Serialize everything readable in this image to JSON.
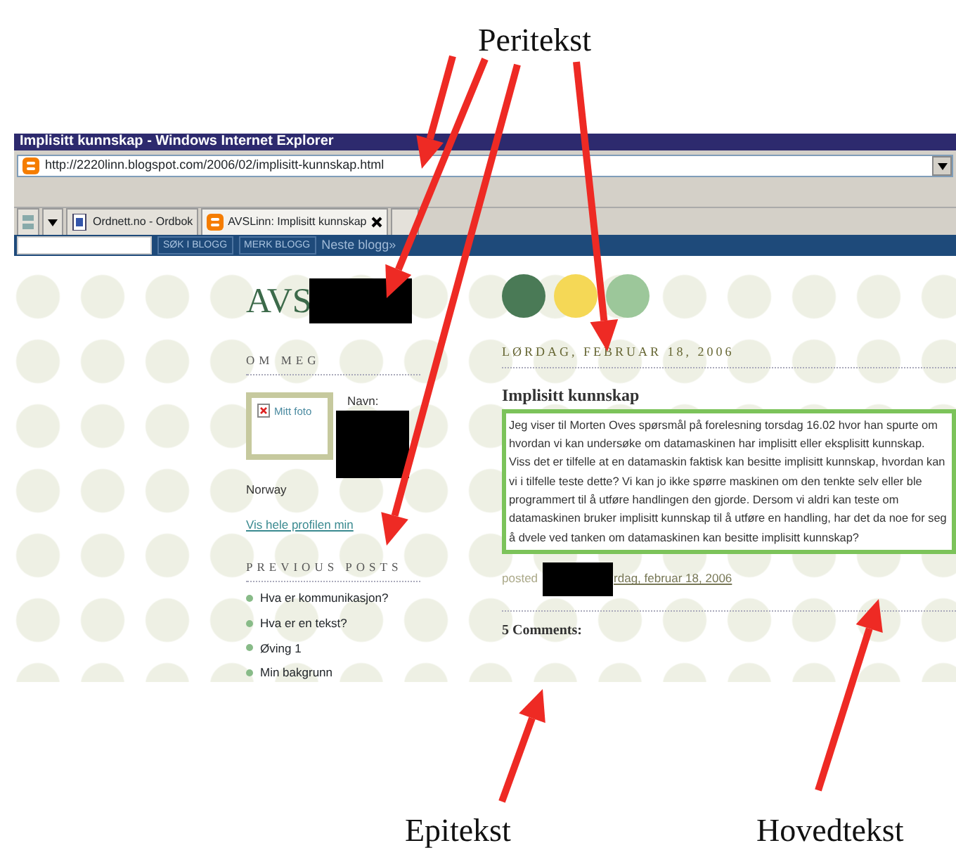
{
  "annotations": [
    {
      "label": "Peritekst"
    },
    {
      "label": "Epitekst"
    },
    {
      "label": "Hovedtekst"
    }
  ],
  "browser": {
    "title": "Implisitt kunnskap - Windows Internet Explorer",
    "address": "http://2220linn.blogspot.com/2006/02/implisitt-kunnskap.html",
    "tabs": [
      {
        "label": "Ordnett.no - Ordbok",
        "selected": false
      },
      {
        "label": "AVSLinn: Implisitt kunnskap",
        "selected": true
      }
    ]
  },
  "blog_navbar": {
    "buttons": [
      "SØK I BLOGG",
      "MERK BLOGG"
    ],
    "link": "Neste blogg»"
  },
  "blog": {
    "title": "AVS",
    "sidebar": {
      "about_heading": "OM MEG",
      "photo_alt": "Mitt foto",
      "name_label": "Navn:",
      "location": "Norway",
      "profile_link": "Vis hele profilen min",
      "previous_heading": "PREVIOUS POSTS",
      "previous_posts": [
        "Hva er kommunikasjon?",
        "Hva er en tekst?",
        "Øving 1",
        "Min bakgrunn"
      ]
    },
    "post": {
      "date": "LØRDAG, FEBRUAR 18, 2006",
      "title": "Implisitt kunnskap",
      "body": "Jeg viser til Morten Oves spørsmål på forelesning torsdag 16.02 hvor han spurte om hvordan vi kan undersøke om datamaskinen har implisitt eller eksplisitt kunnskap. Viss det er tilfelle at en datamaskin faktisk kan besitte implisitt kunnskap, hvordan kan vi i tilfelle teste dette? Vi kan jo ikke spørre maskinen om den tenkte selv eller ble programmert til å utføre handlingen den gjorde. Dersom vi aldri kan teste om datamaskinen bruker implisitt kunnskap til å utføre en handling, har det da noe for seg å dvele ved tanken om datamaskinen kan besitte implisitt kunnskap?",
      "posted_prefix": "posted",
      "posted_suffix": "rdag, februar 18, 2006",
      "comments": "5 Comments:"
    }
  }
}
